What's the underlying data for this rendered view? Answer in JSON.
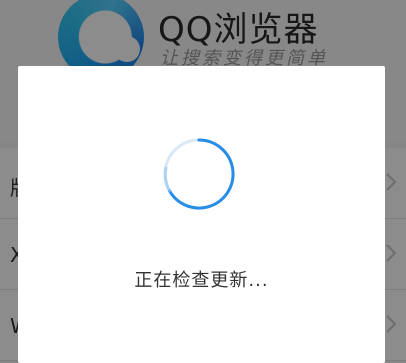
{
  "app": {
    "name": "QQ浏览器",
    "slogan": "让搜索变得更简单"
  },
  "settings_list": {
    "items": [
      {
        "label": "版"
      },
      {
        "label": "X"
      },
      {
        "label": "W"
      }
    ]
  },
  "dialog": {
    "message": "正在检查更新..."
  },
  "colors": {
    "spinner_accent": "#1e88e5",
    "spinner_track": "#cfe3f7",
    "scrim": "#000000"
  },
  "icons": {
    "app_logo": "qq-browser-logo-icon",
    "row_chevron": "chevron-right-icon",
    "loading": "loading-spinner-icon"
  }
}
